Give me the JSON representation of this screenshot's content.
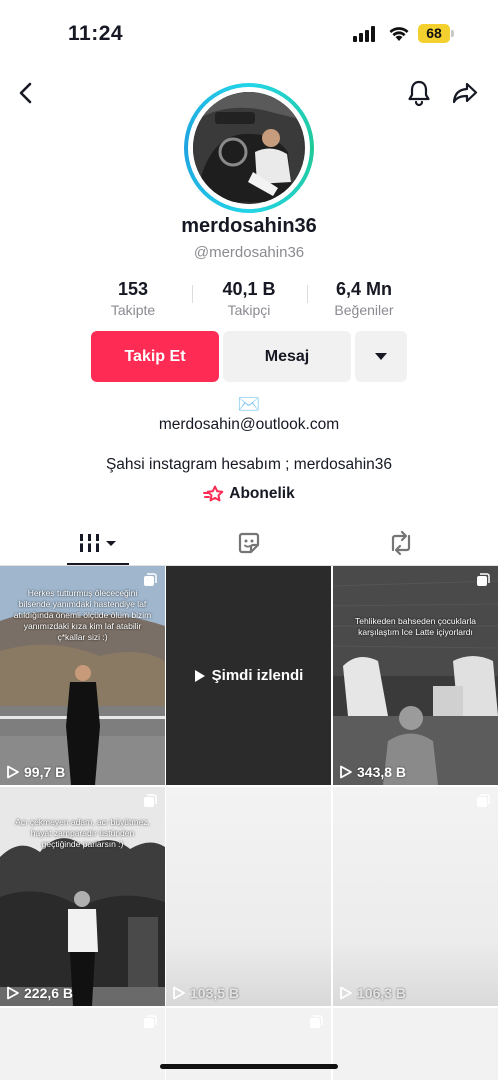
{
  "status_bar": {
    "time": "11:24",
    "battery": "68"
  },
  "profile": {
    "username": "merdosahin36",
    "handle": "@merdosahin36",
    "stats": [
      {
        "value": "153",
        "label": "Takipte"
      },
      {
        "value": "40,1 B",
        "label": "Takipçi"
      },
      {
        "value": "6,4 Mn",
        "label": "Beğeniler"
      }
    ],
    "follow_label": "Takip Et",
    "message_label": "Mesaj",
    "email_emoji": "✉️",
    "email": "merdosahin@outlook.com",
    "bio": "Şahsi instagram hesabım ; merdosahin36",
    "subscription_label": "Abonelik"
  },
  "videos": [
    {
      "views": "99,7 B",
      "caption": "Herkes tutturmuş ölececeğini bilsende yanımdaki hastendiye laf atıldığında önemli ölçüde ölüm bizim yanımızdaki kıza kim laf atabilir ç*kallar sizi :)"
    },
    {
      "views": "",
      "overlay": "Şimdi izlendi"
    },
    {
      "views": "343,8 B",
      "caption": "Tehlikeden bahseden çocuklarla karşılaştım Ice Latte içiyorlardı"
    },
    {
      "views": "222,6 B",
      "caption": "Acı çekmeyen adam, acı büyütmez, hayat zamparadır üstünden geçtiğinde parlarsın :)"
    },
    {
      "views": "103,5 B"
    },
    {
      "views": "106,3 B"
    }
  ],
  "colors": {
    "accent": "#fe2c55",
    "ring": "#23d5e8",
    "muted": "#8a8b91"
  }
}
